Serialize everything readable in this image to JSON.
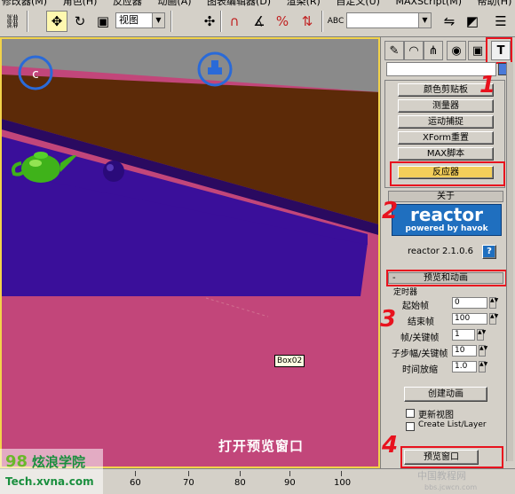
{
  "menu": [
    "修改器(M)",
    "角色(H)",
    "反应器",
    "动画(A)",
    "图表编辑器(D)",
    "渲染(R)",
    "自定义(U)",
    "MAXScript(M)",
    "帮助(H)"
  ],
  "toolbar": {
    "view_dropdown": "视图",
    "abc_label": "ABC"
  },
  "viewport": {
    "object_label": "Box02",
    "caption": "打开预览窗口"
  },
  "panel": {
    "tabs": [
      "create",
      "modify",
      "hierarchy",
      "motion",
      "display",
      "utilities"
    ],
    "utilities": [
      "颜色剪贴板",
      "测量器",
      "运动捕捉",
      "XForm重置",
      "MAX脚本",
      "反应器"
    ],
    "about_title": "关于",
    "reactor_logo": "reactor",
    "reactor_tagline": "powered by havok",
    "reactor_version": "reactor 2.1.0.6",
    "help_button": "?",
    "preview_title": "预览和动画",
    "timer_group": "定时器",
    "fields": [
      {
        "label": "起始帧",
        "value": "0"
      },
      {
        "label": "结束帧",
        "value": "100"
      },
      {
        "label": "帧/关键帧",
        "value": "1"
      },
      {
        "label": "子步幅/关键帧",
        "value": "10"
      },
      {
        "label": "时间放缩",
        "value": "1.0"
      }
    ],
    "create_animation": "创建动画",
    "update_viewports": "更新视图",
    "create_list_layer": "Create List/Layer",
    "preview_window": "预览窗口"
  },
  "annotations": [
    "1",
    "2",
    "3",
    "4"
  ],
  "timeline": {
    "ticks": [
      "60",
      "70",
      "80",
      "90",
      "100"
    ]
  },
  "watermark": {
    "logo": "98",
    "name": "炫浪学院",
    "url": "Tech.xvna.com",
    "site2": "中国教程网",
    "site2_url": "bbs.jcwcn.com"
  }
}
